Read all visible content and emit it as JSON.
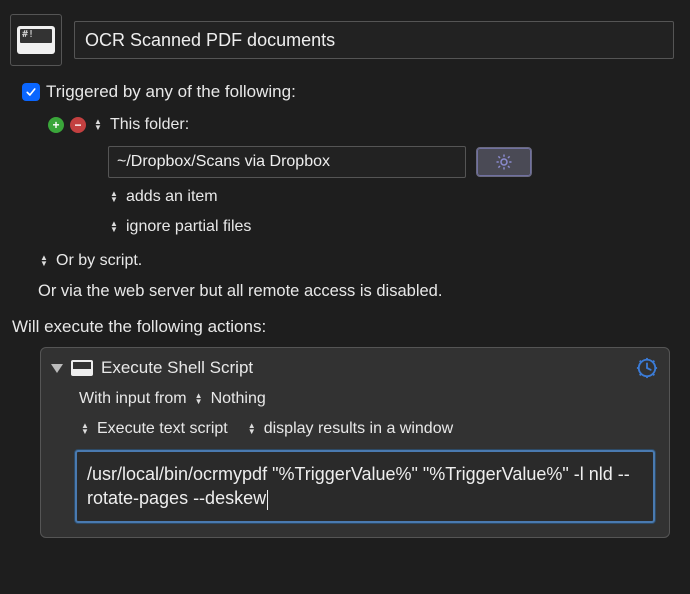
{
  "header": {
    "icon_prompt": "#!",
    "title": "OCR Scanned PDF documents"
  },
  "trigger": {
    "checkbox_checked": true,
    "label": "Triggered by any of the following:",
    "this_folder_label": "This folder:",
    "folder_path": "~/Dropbox/Scans via Dropbox",
    "adds_item_label": "adds an item",
    "ignore_partial_label": "ignore partial files",
    "or_by_script_label": "Or by script.",
    "via_web_label": "Or via the web server but all remote access is disabled."
  },
  "actions_header": "Will execute the following actions:",
  "action": {
    "title": "Execute Shell Script",
    "with_input_label": "With input from",
    "input_source": "Nothing",
    "execute_mode_label": "Execute text script",
    "display_mode_label": "display results in a window",
    "script_text": "/usr/local/bin/ocrmypdf \"%TriggerValue%\" \"%TriggerValue%\" -l nld --rotate-pages --deskew"
  }
}
